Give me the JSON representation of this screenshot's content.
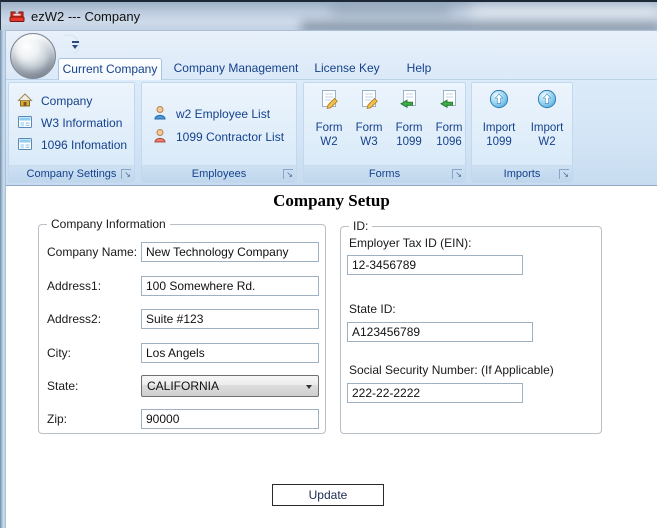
{
  "window": {
    "title": "ezW2 --- Company",
    "app_icon": "ezw2-app-icon"
  },
  "colors": {
    "accent_text": "#15428b",
    "ribbon_bg": "#d7e5f5",
    "content_bg": "#ffffff"
  },
  "tabs": [
    {
      "label": "Current Company",
      "selected": true
    },
    {
      "label": "Company Management",
      "selected": false
    },
    {
      "label": "License Key",
      "selected": false
    },
    {
      "label": "Help",
      "selected": false
    }
  ],
  "ribbon": {
    "orb_icon": "application-orb-icon",
    "quick_access_icon": "customize-quick-access-icon",
    "groups": [
      {
        "label": "Company Settings",
        "items": [
          {
            "label": "Company",
            "icon": "house-icon"
          },
          {
            "label": "W3 Information",
            "icon": "form-table-icon"
          },
          {
            "label": "1096 Infomation",
            "icon": "form-table-icon"
          }
        ]
      },
      {
        "label": "Employees",
        "items": [
          {
            "label": "w2 Employee List",
            "icon": "person-blue-icon"
          },
          {
            "label": "1099 Contractor List",
            "icon": "person-red-icon"
          }
        ]
      },
      {
        "label": "Forms",
        "items": [
          {
            "label": "Form W2",
            "icon": "document-edit-icon"
          },
          {
            "label": "Form W3",
            "icon": "document-edit-icon"
          },
          {
            "label": "Form 1099",
            "icon": "document-import-icon"
          },
          {
            "label": "Form 1096",
            "icon": "document-import-icon"
          }
        ]
      },
      {
        "label": "Imports",
        "items": [
          {
            "label": "Import 1099",
            "icon": "import-sphere-icon"
          },
          {
            "label": "Import W2",
            "icon": "import-sphere-icon"
          }
        ]
      }
    ]
  },
  "content": {
    "heading": "Company Setup",
    "company_info": {
      "legend": "Company Information",
      "fields": [
        {
          "label": "Company Name:",
          "value": "New Technology Company"
        },
        {
          "label": "Address1:",
          "value": "100 Somewhere Rd."
        },
        {
          "label": "Address2:",
          "value": "Suite #123"
        },
        {
          "label": "City:",
          "value": "Los Angels"
        },
        {
          "label": "State:",
          "value": "CALIFORNIA",
          "type": "select"
        },
        {
          "label": "Zip:",
          "value": "90000"
        }
      ]
    },
    "ids": {
      "legend": "ID:",
      "fields": [
        {
          "label": "Employer Tax ID (EIN):",
          "value": "12-3456789"
        },
        {
          "label": "State ID:",
          "value": "A123456789"
        },
        {
          "label": "Social Security Number: (If Applicable)",
          "value": "222-22-2222"
        }
      ]
    },
    "update_button": "Update"
  }
}
